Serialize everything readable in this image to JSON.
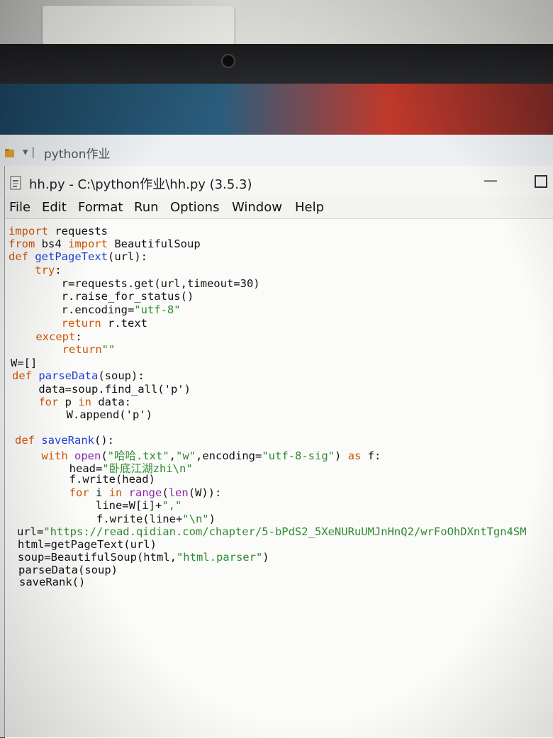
{
  "explorer": {
    "title": "python作业"
  },
  "window": {
    "title": "hh.py - C:\\python作业\\hh.py (3.5.3)"
  },
  "menubar": {
    "items": [
      "File",
      "Edit",
      "Format",
      "Run",
      "Options",
      "Window",
      "Help"
    ]
  },
  "code": {
    "lines": [
      [
        {
          "t": "import",
          "c": "kw"
        },
        {
          "t": " requests"
        }
      ],
      [
        {
          "t": "from",
          "c": "kw"
        },
        {
          "t": " bs4 "
        },
        {
          "t": "import",
          "c": "kw"
        },
        {
          "t": " BeautifulSoup"
        }
      ],
      [
        {
          "t": "def",
          "c": "kw"
        },
        {
          "t": " "
        },
        {
          "t": "getPageText",
          "c": "df"
        },
        {
          "t": "(url):"
        }
      ],
      [
        {
          "t": "    "
        },
        {
          "t": "try",
          "c": "kw"
        },
        {
          "t": ":"
        }
      ],
      [
        {
          "t": "        r=requests.get(url,timeout=30)"
        }
      ],
      [
        {
          "t": "        r.raise_for_status()"
        }
      ],
      [
        {
          "t": "        r.encoding="
        },
        {
          "t": "\"utf-8\"",
          "c": "st"
        }
      ],
      [
        {
          "t": "        "
        },
        {
          "t": "return",
          "c": "kw"
        },
        {
          "t": " r.text"
        }
      ],
      [
        {
          "t": "    "
        },
        {
          "t": "except",
          "c": "kw"
        },
        {
          "t": ":"
        }
      ],
      [
        {
          "t": "        "
        },
        {
          "t": "return",
          "c": "kw"
        },
        {
          "t": "\"\"",
          "c": "st"
        }
      ],
      [
        {
          "t": "W=[]"
        }
      ],
      [
        {
          "t": "def",
          "c": "kw"
        },
        {
          "t": " "
        },
        {
          "t": "parseData",
          "c": "df"
        },
        {
          "t": "(soup):"
        }
      ],
      [
        {
          "t": "    data=soup.find_all('p')"
        }
      ],
      [
        {
          "t": "    "
        },
        {
          "t": "for",
          "c": "kw"
        },
        {
          "t": " p "
        },
        {
          "t": "in",
          "c": "kw"
        },
        {
          "t": " data:"
        }
      ],
      [
        {
          "t": "        W.append('p')"
        }
      ],
      [
        {
          "t": ""
        }
      ],
      [
        {
          "t": "def",
          "c": "kw"
        },
        {
          "t": " "
        },
        {
          "t": "saveRank",
          "c": "df"
        },
        {
          "t": "():"
        }
      ],
      [
        {
          "t": "    "
        },
        {
          "t": "with",
          "c": "kw"
        },
        {
          "t": " "
        },
        {
          "t": "open",
          "c": "bi"
        },
        {
          "t": "("
        },
        {
          "t": "\"哈哈.txt\"",
          "c": "st"
        },
        {
          "t": ","
        },
        {
          "t": "\"w\"",
          "c": "st"
        },
        {
          "t": ",encoding="
        },
        {
          "t": "\"utf-8-sig\"",
          "c": "st"
        },
        {
          "t": ") "
        },
        {
          "t": "as",
          "c": "kw"
        },
        {
          "t": " f:"
        }
      ],
      [
        {
          "t": "        head="
        },
        {
          "t": "\"卧底江湖zhi\\n\"",
          "c": "st"
        }
      ],
      [
        {
          "t": "        f.write(head)"
        }
      ],
      [
        {
          "t": "        "
        },
        {
          "t": "for",
          "c": "kw"
        },
        {
          "t": " i "
        },
        {
          "t": "in",
          "c": "kw"
        },
        {
          "t": " "
        },
        {
          "t": "range",
          "c": "bi"
        },
        {
          "t": "("
        },
        {
          "t": "len",
          "c": "bi"
        },
        {
          "t": "(W)):"
        }
      ],
      [
        {
          "t": "            line=W[i]+"
        },
        {
          "t": "\",\"",
          "c": "st"
        }
      ],
      [
        {
          "t": "            f.write(line+"
        },
        {
          "t": "\"\\n\"",
          "c": "st"
        },
        {
          "t": ")"
        }
      ],
      [
        {
          "t": "url="
        },
        {
          "t": "\"https://read.qidian.com/chapter/5-bPdS2_5XeNURuUMJnHnQ2/wrFoOhDXntTgn4SM",
          "c": "st"
        }
      ],
      [
        {
          "t": "html=getPageText(url)"
        }
      ],
      [
        {
          "t": "soup=BeautifulSoup(html,"
        },
        {
          "t": "\"html.parser\"",
          "c": "st"
        },
        {
          "t": ")"
        }
      ],
      [
        {
          "t": "parseData(soup)"
        }
      ],
      [
        {
          "t": "saveRank()"
        }
      ]
    ]
  }
}
